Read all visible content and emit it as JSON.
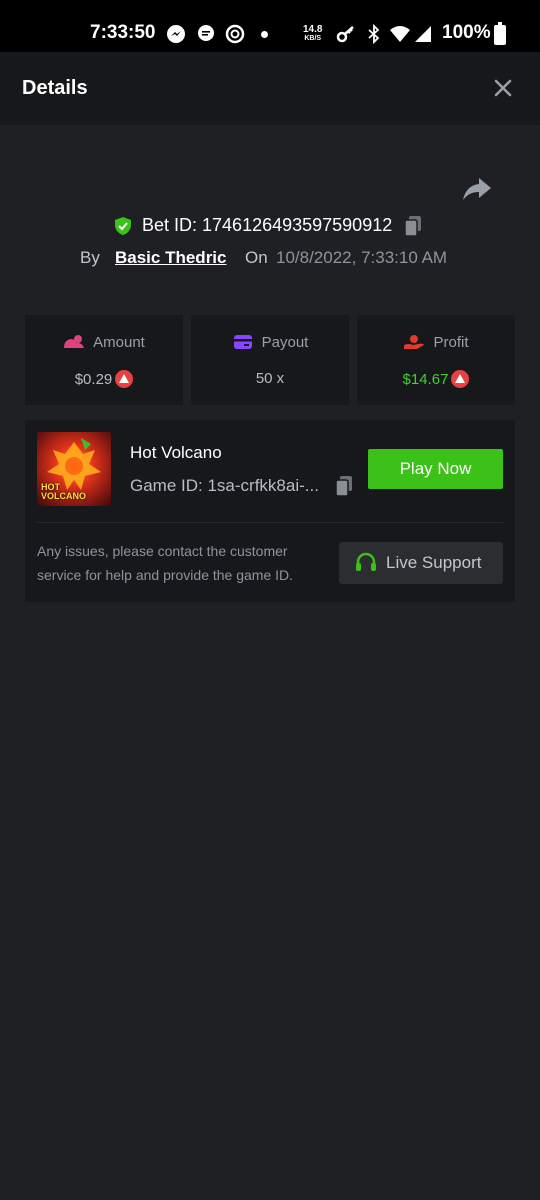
{
  "status_bar": {
    "time": "7:33:50",
    "net_speed_value": "14.8",
    "net_speed_unit": "KB/S",
    "battery": "100%"
  },
  "header": {
    "title": "Details"
  },
  "bet": {
    "id_text": "Bet ID: 1746126493597590912",
    "by_label": "By",
    "user": "Basic Thedric",
    "on_label": "On",
    "date": "10/8/2022, 7:33:10 AM"
  },
  "stats": [
    {
      "label": "Amount",
      "value": "$0.29",
      "icon": "coins-icon",
      "color": "#e0427f"
    },
    {
      "label": "Payout",
      "value": "50 x",
      "icon": "card-icon",
      "color": "#8a45ff"
    },
    {
      "label": "Profit",
      "value": "$14.67",
      "icon": "hand-coin-icon",
      "color": "#e03a2f"
    }
  ],
  "game": {
    "name": "Hot Volcano",
    "id_text": "Game ID: 1sa-crfkk8ai-...",
    "thumb_line1": "HOT",
    "thumb_line2": "VOLCANO",
    "play_label": "Play Now",
    "help_text": "Any issues, please contact the customer service for help and provide the game ID.",
    "support_label": "Live Support"
  },
  "colors": {
    "accent_green": "#3bc117",
    "profit_green": "#3fd12f",
    "coin_red": "#e84142"
  }
}
